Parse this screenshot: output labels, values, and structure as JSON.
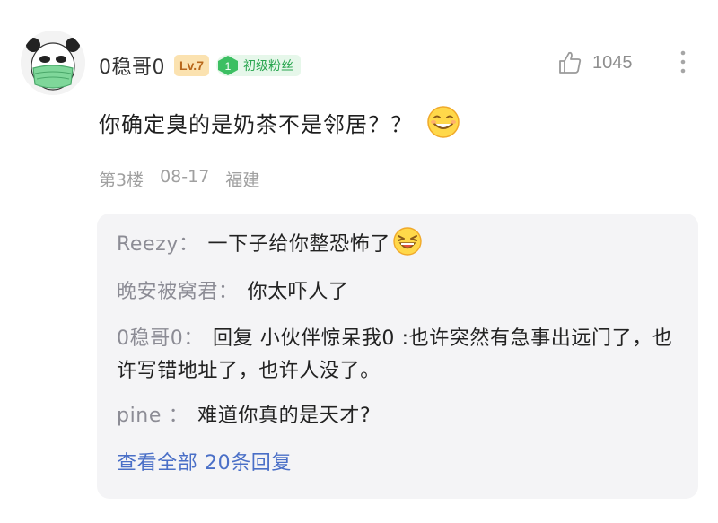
{
  "comment": {
    "username": "0稳哥0",
    "level_badge": "Lv.7",
    "fan_badge": {
      "number": "1",
      "label": "初级粉丝"
    },
    "like_count": "1045",
    "content": "你确定臭的是奶茶不是邻居？？",
    "meta": {
      "floor": "第3楼",
      "date": "08-17",
      "location": "福建"
    },
    "icons": {
      "avatar": "panda-mask-avatar",
      "like": "thumbs-up-icon",
      "more": "more-vertical-icon",
      "emoji": "smiling-emoji",
      "reply_emoji": "laughing-emoji"
    }
  },
  "replies": [
    {
      "author": "Reezy",
      "separator": "：",
      "text": "一下子给你整恐怖了"
    },
    {
      "author": "晚安被窝君",
      "separator": "：",
      "text": "你太吓人了"
    },
    {
      "author": "0稳哥0",
      "separator": "：",
      "text": "回复 小伙伴惊呆我0 :也许突然有急事出远门了，也许写错地址了，也许人没了。"
    },
    {
      "author": "pine ",
      "separator": "：",
      "text": "难道你真的是天才?"
    }
  ],
  "view_all": "查看全部 20条回复",
  "colors": {
    "level_bg": "#fbe2b0",
    "level_text": "#b8671a",
    "fan_bg": "#e6f7ea",
    "fan_text": "#2aa650",
    "reply_author": "#8c8c95",
    "link": "#4a6fc7",
    "reply_box_bg": "#f4f4f6"
  }
}
